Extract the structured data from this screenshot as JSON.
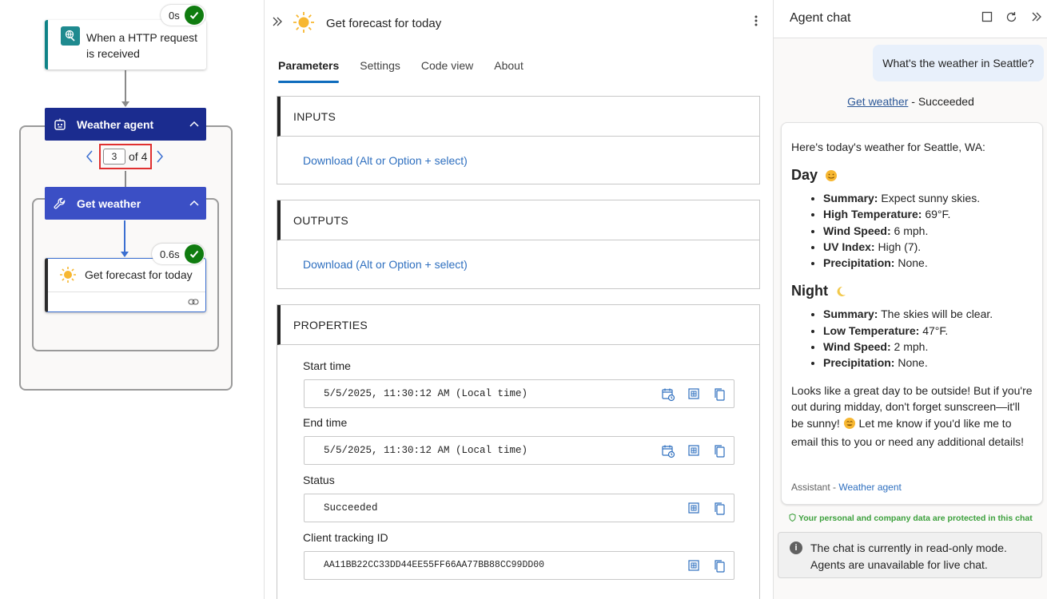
{
  "canvas": {
    "trigger": {
      "label": "When a HTTP request is received",
      "duration": "0s"
    },
    "agent_scope": {
      "label": "Weather agent"
    },
    "pager": {
      "current": "3",
      "of_label": "of 4"
    },
    "tool_scope": {
      "label": "Get weather"
    },
    "action": {
      "label": "Get forecast for today",
      "duration": "0.6s"
    }
  },
  "details": {
    "title": "Get forecast for today",
    "tabs": [
      "Parameters",
      "Settings",
      "Code view",
      "About"
    ],
    "active_tab": "Parameters",
    "inputs": {
      "header": "INPUTS",
      "link": "Download (Alt or Option + select)"
    },
    "outputs": {
      "header": "OUTPUTS",
      "link": "Download (Alt or Option + select)"
    },
    "properties": {
      "header": "PROPERTIES",
      "start_time": {
        "label": "Start time",
        "value": "5/5/2025, 11:30:12 AM (Local time)"
      },
      "end_time": {
        "label": "End time",
        "value": "5/5/2025, 11:30:12 AM (Local time)"
      },
      "status": {
        "label": "Status",
        "value": "Succeeded"
      },
      "client_tracking_id": {
        "label": "Client tracking ID",
        "value": "AA11BB22CC33DD44EE55FF66AA77BB88CC99DD00"
      }
    }
  },
  "chat": {
    "title": "Agent chat",
    "user_message": "What's the weather in Seattle?",
    "tool_call": {
      "name": "Get weather",
      "status": " - Succeeded"
    },
    "response": {
      "intro": "Here's today's weather for Seattle, WA:",
      "day": {
        "heading": "Day",
        "items": [
          {
            "key": "Summary:",
            "value": " Expect sunny skies."
          },
          {
            "key": "High Temperature:",
            "value": " 69°F."
          },
          {
            "key": "Wind Speed:",
            "value": " 6 mph."
          },
          {
            "key": "UV Index:",
            "value": " High (7)."
          },
          {
            "key": "Precipitation:",
            "value": " None."
          }
        ]
      },
      "night": {
        "heading": "Night",
        "items": [
          {
            "key": "Summary:",
            "value": " The skies will be clear."
          },
          {
            "key": "Low Temperature:",
            "value": " 47°F."
          },
          {
            "key": "Wind Speed:",
            "value": " 2 mph."
          },
          {
            "key": "Precipitation:",
            "value": " None."
          }
        ]
      },
      "closing_part1": "Looks like a great day to be outside! But if you're out during midday, don't forget sunscreen—it'll be sunny!",
      "closing_part2": " Let me know if you'd like me to email this to you or need any additional details!",
      "signature_role": "Assistant",
      "signature_sep": " - ",
      "signature_agent": "Weather agent"
    },
    "privacy_notice": "Your personal and company data are protected in this chat",
    "readonly_notice": "The chat is currently in read-only mode. Agents are unavailable for live chat."
  },
  "colors": {
    "agent_header": "#1b2c8f",
    "tool_header": "#3b4fc5",
    "success": "#107c10",
    "link": "#2e6fbf",
    "active_tab": "#0f6cbd",
    "highlight_box": "#e03030"
  }
}
